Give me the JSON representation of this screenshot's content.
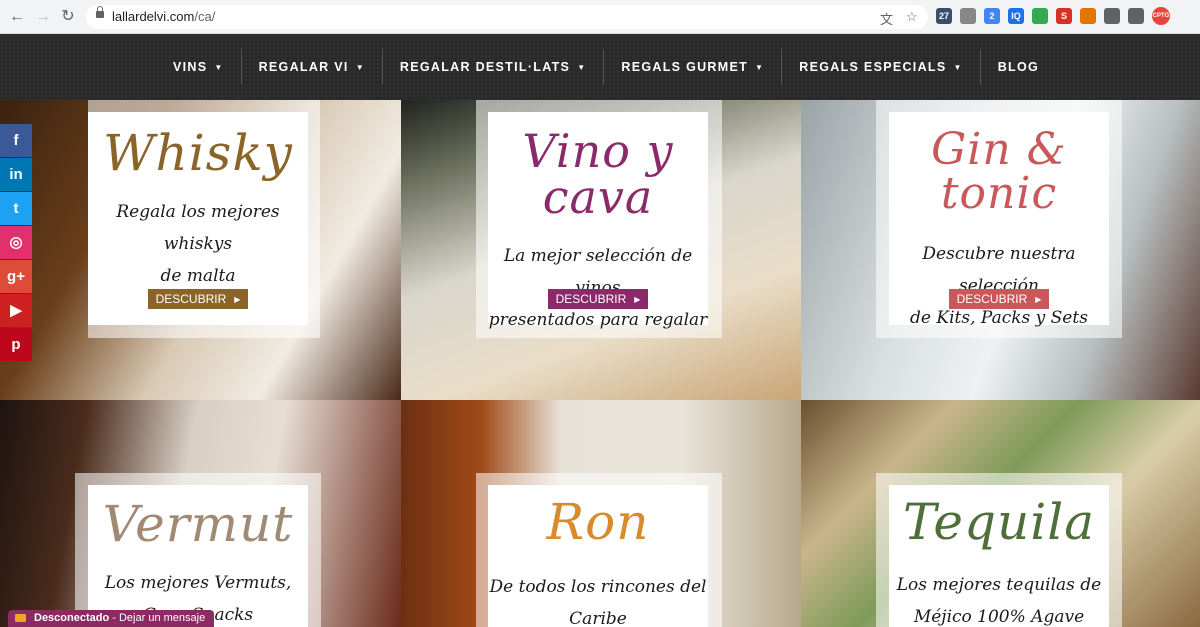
{
  "browser": {
    "url_host": "lallardelvi.com",
    "url_path": "/ca/",
    "extensions": [
      {
        "name": "calendar-ext-icon",
        "badge": "27",
        "color": "#3a4f6b"
      },
      {
        "name": "circle-ext-icon",
        "badge": "",
        "color": "#888888"
      },
      {
        "name": "puzzle-ext-icon",
        "badge": "2",
        "color": "#4285f4"
      },
      {
        "name": "iq-ext-icon",
        "badge": "IQ",
        "color": "#1a73e8"
      },
      {
        "name": "chat-ext-icon",
        "badge": "",
        "color": "#34a853"
      },
      {
        "name": "s-ext-icon",
        "badge": "S",
        "color": "#d93025"
      },
      {
        "name": "arrows-ext-icon",
        "badge": "",
        "color": "#e37400"
      },
      {
        "name": "extensions-icon",
        "badge": "",
        "color": "#5f6368"
      },
      {
        "name": "playlist-icon",
        "badge": "",
        "color": "#5f6368"
      },
      {
        "name": "profile-avatar",
        "badge": "CPTG",
        "color": "#e8453c"
      }
    ]
  },
  "nav": {
    "items": [
      {
        "label": "VINS",
        "caret": true
      },
      {
        "label": "REGALAR VI",
        "caret": true
      },
      {
        "label": "REGALAR DESTIL·LATS",
        "caret": true
      },
      {
        "label": "REGALS GURMET",
        "caret": true
      },
      {
        "label": "REGALS ESPECIALS",
        "caret": true
      },
      {
        "label": "BLOG",
        "caret": false
      }
    ]
  },
  "social": [
    {
      "name": "facebook-icon",
      "glyph": "f",
      "color": "#3b5998"
    },
    {
      "name": "linkedin-icon",
      "glyph": "in",
      "color": "#0077b5"
    },
    {
      "name": "twitter-icon",
      "glyph": "t",
      "color": "#1da1f2"
    },
    {
      "name": "instagram-icon",
      "glyph": "◎",
      "color": "#e1306c"
    },
    {
      "name": "googleplus-icon",
      "glyph": "g+",
      "color": "#dd4b39"
    },
    {
      "name": "youtube-icon",
      "glyph": "▶",
      "color": "#cd201f"
    },
    {
      "name": "pinterest-icon",
      "glyph": "p",
      "color": "#bd081c"
    }
  ],
  "cards": [
    {
      "title": "Whisky",
      "desc_1": "Regala los mejores whiskys",
      "desc_2": "de malta",
      "cta": "DESCUBRIR",
      "color": "#8a6428"
    },
    {
      "title": "Vino y cava",
      "desc_1": "La mejor selección de vinos",
      "desc_2": "presentados para regalar",
      "cta": "DESCUBRIR",
      "color": "#8b2a6b"
    },
    {
      "title": "Gin & tonic",
      "desc_1": "Descubre nuestra selección",
      "desc_2": "de Kits, Packs y Sets",
      "cta": "DESCUBRIR",
      "color": "#c9585a"
    },
    {
      "title": "Vermut",
      "desc_1": "Los mejores Vermuts,",
      "desc_2": "C... y Snacks",
      "cta": "",
      "color": "#a08a74"
    },
    {
      "title": "Ron",
      "desc_1": "De todos los rincones del",
      "desc_2": "Caribe",
      "cta": "",
      "color": "#d98a2a"
    },
    {
      "title": "Tequila",
      "desc_1": "Los mejores tequilas de",
      "desc_2": "Méjico 100% Agave",
      "cta": "",
      "color": "#4e6e3a"
    }
  ],
  "chat": {
    "status": "Desconectado",
    "separator": " - ",
    "action": "Dejar un mensaje"
  }
}
